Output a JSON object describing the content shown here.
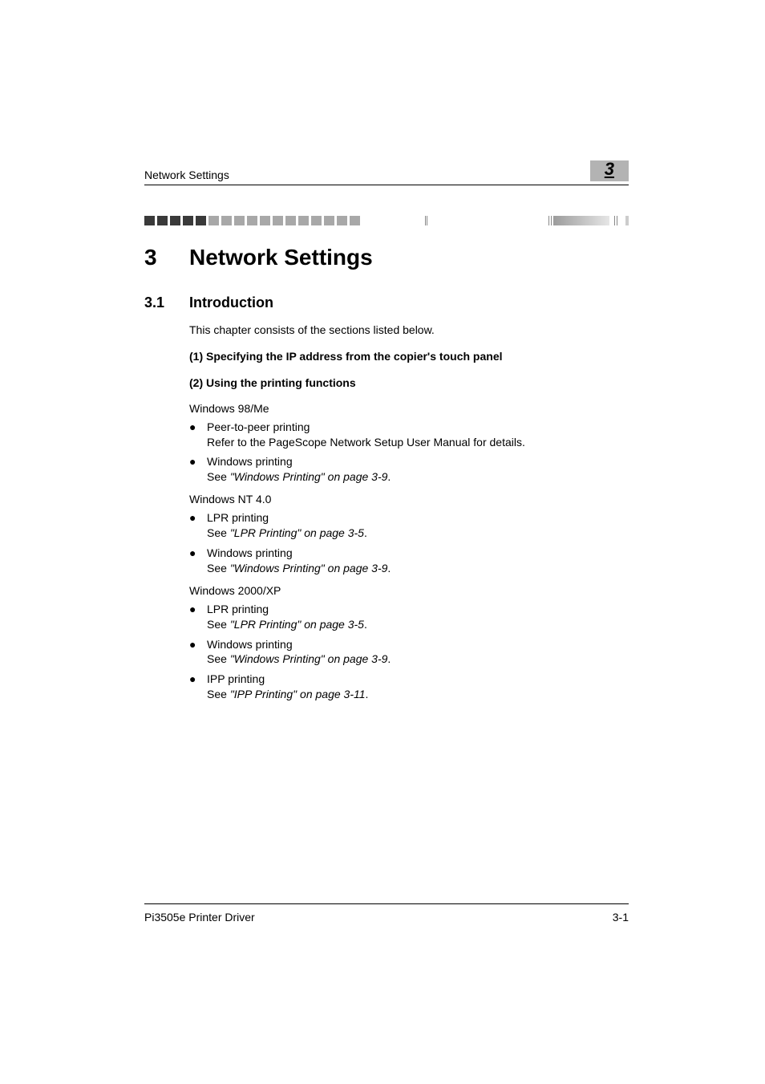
{
  "header": {
    "section_label": "Network Settings",
    "chapter_badge": "3"
  },
  "chapter": {
    "number": "3",
    "title": "Network Settings"
  },
  "section": {
    "number": "3.1",
    "title": "Introduction"
  },
  "intro_para": "This chapter consists of the sections listed below.",
  "spec_line_1": "(1) Specifying the IP address from the copier's touch panel",
  "spec_line_2": "(2) Using the printing functions",
  "groups": [
    {
      "os": "Windows 98/Me",
      "items": [
        {
          "title": "Peer-to-peer printing",
          "detail_prefix": "Refer to the PageScope Network Setup User Manual for details.",
          "detail_italic": ""
        },
        {
          "title": "Windows printing",
          "detail_prefix": "See ",
          "detail_italic": "\"Windows Printing\" on page 3-9",
          "detail_suffix": "."
        }
      ]
    },
    {
      "os": "Windows NT 4.0",
      "items": [
        {
          "title": "LPR printing",
          "detail_prefix": "See ",
          "detail_italic": "\"LPR Printing\" on page 3-5",
          "detail_suffix": "."
        },
        {
          "title": "Windows printing",
          "detail_prefix": "See ",
          "detail_italic": "\"Windows Printing\" on page 3-9",
          "detail_suffix": "."
        }
      ]
    },
    {
      "os": "Windows 2000/XP",
      "items": [
        {
          "title": "LPR printing",
          "detail_prefix": "See ",
          "detail_italic": "\"LPR Printing\" on page 3-5",
          "detail_suffix": "."
        },
        {
          "title": "Windows printing",
          "detail_prefix": "See ",
          "detail_italic": "\"Windows Printing\" on page 3-9",
          "detail_suffix": "."
        },
        {
          "title": "IPP printing",
          "detail_prefix": "See ",
          "detail_italic": "\"IPP Printing\" on page 3-11",
          "detail_suffix": "."
        }
      ]
    }
  ],
  "footer": {
    "left": "Pi3505e Printer Driver",
    "right": "3-1"
  }
}
